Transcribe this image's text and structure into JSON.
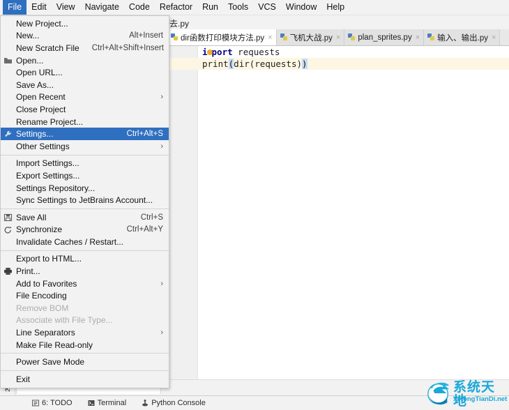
{
  "menubar": {
    "items": [
      {
        "label": "File",
        "active": true
      },
      {
        "label": "Edit",
        "active": false
      },
      {
        "label": "View",
        "active": false
      },
      {
        "label": "Navigate",
        "active": false
      },
      {
        "label": "Code",
        "active": false
      },
      {
        "label": "Refactor",
        "active": false
      },
      {
        "label": "Run",
        "active": false
      },
      {
        "label": "Tools",
        "active": false
      },
      {
        "label": "VCS",
        "active": false
      },
      {
        "label": "Window",
        "active": false
      },
      {
        "label": "Help",
        "active": false
      }
    ]
  },
  "file_menu": {
    "items": [
      {
        "label": "New Project...",
        "accel": "",
        "icon": "",
        "sel": false,
        "arrow": false,
        "disabled": false
      },
      {
        "label": "New...",
        "accel": "Alt+Insert",
        "icon": "",
        "sel": false,
        "arrow": false,
        "disabled": false
      },
      {
        "label": "New Scratch File",
        "accel": "Ctrl+Alt+Shift+Insert",
        "icon": "",
        "sel": false,
        "arrow": false,
        "disabled": false
      },
      {
        "label": "Open...",
        "accel": "",
        "icon": "folder-icon",
        "sel": false,
        "arrow": false,
        "disabled": false
      },
      {
        "label": "Open URL...",
        "accel": "",
        "icon": "",
        "sel": false,
        "arrow": false,
        "disabled": false
      },
      {
        "label": "Save As...",
        "accel": "",
        "icon": "",
        "sel": false,
        "arrow": false,
        "disabled": false
      },
      {
        "label": "Open Recent",
        "accel": "",
        "icon": "",
        "sel": false,
        "arrow": true,
        "disabled": false
      },
      {
        "label": "Close Project",
        "accel": "",
        "icon": "",
        "sel": false,
        "arrow": false,
        "disabled": false
      },
      {
        "label": "Rename Project...",
        "accel": "",
        "icon": "",
        "sel": false,
        "arrow": false,
        "disabled": false
      },
      {
        "label": "Settings...",
        "accel": "Ctrl+Alt+S",
        "icon": "wrench-icon",
        "sel": true,
        "arrow": false,
        "disabled": false
      },
      {
        "label": "Other Settings",
        "accel": "",
        "icon": "",
        "sel": false,
        "arrow": true,
        "disabled": false
      },
      {
        "separator": true
      },
      {
        "label": "Import Settings...",
        "accel": "",
        "icon": "",
        "sel": false,
        "arrow": false,
        "disabled": false
      },
      {
        "label": "Export Settings...",
        "accel": "",
        "icon": "",
        "sel": false,
        "arrow": false,
        "disabled": false
      },
      {
        "label": "Settings Repository...",
        "accel": "",
        "icon": "",
        "sel": false,
        "arrow": false,
        "disabled": false
      },
      {
        "label": "Sync Settings to JetBrains Account...",
        "accel": "",
        "icon": "",
        "sel": false,
        "arrow": false,
        "disabled": false
      },
      {
        "separator": true
      },
      {
        "label": "Save All",
        "accel": "Ctrl+S",
        "icon": "save-icon",
        "sel": false,
        "arrow": false,
        "disabled": false
      },
      {
        "label": "Synchronize",
        "accel": "Ctrl+Alt+Y",
        "icon": "sync-icon",
        "sel": false,
        "arrow": false,
        "disabled": false
      },
      {
        "label": "Invalidate Caches / Restart...",
        "accel": "",
        "icon": "",
        "sel": false,
        "arrow": false,
        "disabled": false
      },
      {
        "separator": true
      },
      {
        "label": "Export to HTML...",
        "accel": "",
        "icon": "",
        "sel": false,
        "arrow": false,
        "disabled": false
      },
      {
        "label": "Print...",
        "accel": "",
        "icon": "print-icon",
        "sel": false,
        "arrow": false,
        "disabled": false
      },
      {
        "label": "Add to Favorites",
        "accel": "",
        "icon": "",
        "sel": false,
        "arrow": true,
        "disabled": false
      },
      {
        "label": "File Encoding",
        "accel": "",
        "icon": "",
        "sel": false,
        "arrow": false,
        "disabled": false
      },
      {
        "label": "Remove BOM",
        "accel": "",
        "icon": "",
        "sel": false,
        "arrow": false,
        "disabled": true
      },
      {
        "label": "Associate with File Type...",
        "accel": "",
        "icon": "",
        "sel": false,
        "arrow": false,
        "disabled": true
      },
      {
        "label": "Line Separators",
        "accel": "",
        "icon": "",
        "sel": false,
        "arrow": true,
        "disabled": false
      },
      {
        "label": "Make File Read-only",
        "accel": "",
        "icon": "",
        "sel": false,
        "arrow": false,
        "disabled": false
      },
      {
        "separator": true
      },
      {
        "label": "Power Save Mode",
        "accel": "",
        "icon": "",
        "sel": false,
        "arrow": false,
        "disabled": false
      },
      {
        "separator": true
      },
      {
        "label": "Exit",
        "accel": "",
        "icon": "",
        "sel": false,
        "arrow": false,
        "disabled": false
      }
    ]
  },
  "editor": {
    "breadcrumb": "去.py",
    "tabs": [
      {
        "label": "dir函数打印模块方法.py",
        "selected": true,
        "close": "×"
      },
      {
        "label": "飞机大战.py",
        "selected": false,
        "close": "×"
      },
      {
        "label": "plan_sprites.py",
        "selected": false,
        "close": "×"
      },
      {
        "label": "输入、输出.py",
        "selected": false,
        "close": "×"
      }
    ],
    "code": {
      "line1_kw": "i",
      "line1_kw_tail": "port",
      "line1_rest": " requests",
      "line2_a": "print",
      "line2_paren_open": "(",
      "line2_mid": "dir(requests)",
      "line2_paren_close": ")"
    }
  },
  "left_rail": {
    "label": "2: Favorites",
    "star": "★"
  },
  "bottombar": {
    "items": [
      {
        "label": "6: TODO",
        "icon": "todo-icon"
      },
      {
        "label": "Terminal",
        "icon": "terminal-icon"
      },
      {
        "label": "Python Console",
        "icon": "python-console-icon"
      }
    ]
  },
  "watermark": {
    "cn": "系统天地",
    "en": "XiTongTianDi.net",
    "color": "#1aa8d8"
  },
  "colors": {
    "accent": "#2f6fbf",
    "menu_bg": "#f2f2f2",
    "code_bg": "#ffffff",
    "line_highlight": "#fdf6e3"
  }
}
